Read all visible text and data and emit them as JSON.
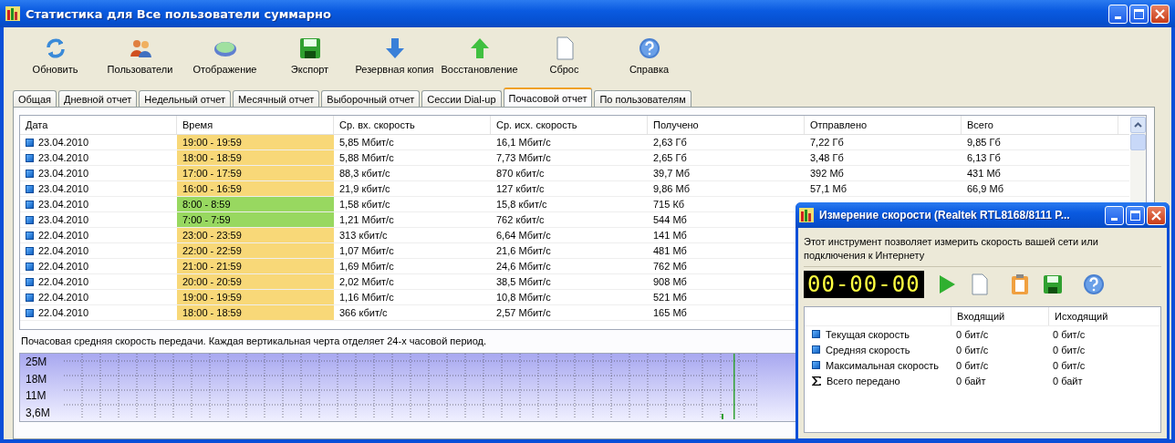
{
  "window": {
    "title": "Статистика для Все  пользователи суммарно"
  },
  "toolbar": [
    {
      "label": "Обновить",
      "kind": "refresh"
    },
    {
      "label": "Пользователи",
      "kind": "users"
    },
    {
      "label": "Отображение",
      "kind": "display"
    },
    {
      "label": "Экспорт",
      "kind": "save"
    },
    {
      "label": "Резервная копия",
      "kind": "down"
    },
    {
      "label": "Восстановление",
      "kind": "up"
    },
    {
      "label": "Сброс",
      "kind": "page"
    },
    {
      "label": "Справка",
      "kind": "help"
    }
  ],
  "tabs": [
    {
      "label": "Общая",
      "selected": false
    },
    {
      "label": "Дневной отчет",
      "selected": false
    },
    {
      "label": "Недельный отчет",
      "selected": false
    },
    {
      "label": "Месячный отчет",
      "selected": false
    },
    {
      "label": "Выборочный отчет",
      "selected": false
    },
    {
      "label": "Сессии Dial-up",
      "selected": false
    },
    {
      "label": "Почасовой отчет",
      "selected": true
    },
    {
      "label": "По пользователям",
      "selected": false
    }
  ],
  "table": {
    "columns": [
      "Дата",
      "Время",
      "Ср. вх. скорость",
      "Ср. исх. скорость",
      "Получено",
      "Отправлено",
      "Всего"
    ],
    "rows": [
      {
        "cells": [
          "23.04.2010",
          "19:00 - 19:59",
          "5,85 Мбит/с",
          "16,1 Мбит/с",
          "2,63 Гб",
          "7,22 Гб",
          "9,85 Гб"
        ],
        "color": "#f8d878"
      },
      {
        "cells": [
          "23.04.2010",
          "18:00 - 18:59",
          "5,88 Мбит/с",
          "7,73 Мбит/с",
          "2,65 Гб",
          "3,48 Гб",
          "6,13 Гб"
        ],
        "color": "#f8d878"
      },
      {
        "cells": [
          "23.04.2010",
          "17:00 - 17:59",
          "88,3 кбит/с",
          "870 кбит/с",
          "39,7 Мб",
          "392 Мб",
          "431 Мб"
        ],
        "color": "#f8d878"
      },
      {
        "cells": [
          "23.04.2010",
          "16:00 - 16:59",
          "21,9 кбит/с",
          "127 кбит/с",
          "9,86 Мб",
          "57,1 Мб",
          "66,9 Мб"
        ],
        "color": "#f8d878"
      },
      {
        "cells": [
          "23.04.2010",
          "8:00 - 8:59",
          "1,58 кбит/с",
          "15,8 кбит/с",
          "715 Кб"
        ],
        "color": "#98d860"
      },
      {
        "cells": [
          "23.04.2010",
          "7:00 - 7:59",
          "1,21 Мбит/с",
          "762 кбит/с",
          "544 Мб"
        ],
        "color": "#98d860"
      },
      {
        "cells": [
          "22.04.2010",
          "23:00 - 23:59",
          "313 кбит/с",
          "6,64 Мбит/с",
          "141 Мб"
        ],
        "color": "#f8d878"
      },
      {
        "cells": [
          "22.04.2010",
          "22:00 - 22:59",
          "1,07 Мбит/с",
          "21,6 Мбит/с",
          "481 Мб"
        ],
        "color": "#f8d878"
      },
      {
        "cells": [
          "22.04.2010",
          "21:00 - 21:59",
          "1,69 Мбит/с",
          "24,6 Мбит/с",
          "762 Мб"
        ],
        "color": "#f8d878"
      },
      {
        "cells": [
          "22.04.2010",
          "20:00 - 20:59",
          "2,02 Мбит/с",
          "38,5 Мбит/с",
          "908 Мб"
        ],
        "color": "#f8d878"
      },
      {
        "cells": [
          "22.04.2010",
          "19:00 - 19:59",
          "1,16 Мбит/с",
          "10,8 Мбит/с",
          "521 Мб"
        ],
        "color": "#f8d878"
      },
      {
        "cells": [
          "22.04.2010",
          "18:00 - 18:59",
          "366 кбит/с",
          "2,57 Мбит/с",
          "165 Мб"
        ],
        "color": "#f8d878"
      }
    ]
  },
  "graph": {
    "caption": "Почасовая средняя скорость передачи. Каждая вертикальная черта отделяет 24-х часовой период.",
    "axis_labels": [
      "25M",
      "18M",
      "11M",
      "3,6M"
    ]
  },
  "speed_window": {
    "title": "Измерение скорости (Realtek RTL8168/8111 P...",
    "description": "Этот инструмент позволяет измерить скорость вашей сети или подключения к Интернету",
    "timer": "00-00-00",
    "tools": [
      {
        "kind": "play"
      },
      {
        "kind": "page"
      },
      {
        "kind": "clipboard"
      },
      {
        "kind": "save"
      },
      {
        "kind": "help"
      }
    ],
    "columns": [
      "Входящий",
      "Исходящий"
    ],
    "rows": [
      {
        "label": "Текущая скорость",
        "kind": "square",
        "values": [
          "0 бит/с",
          "0 бит/с"
        ]
      },
      {
        "label": "Средняя скорость",
        "kind": "square",
        "values": [
          "0 бит/с",
          "0 бит/с"
        ]
      },
      {
        "label": "Максимальная скорость",
        "kind": "square",
        "values": [
          "0 бит/с",
          "0 бит/с"
        ]
      },
      {
        "label": "Всего передано",
        "kind": "sum",
        "values": [
          "0 байт",
          "0 байт"
        ]
      }
    ]
  }
}
